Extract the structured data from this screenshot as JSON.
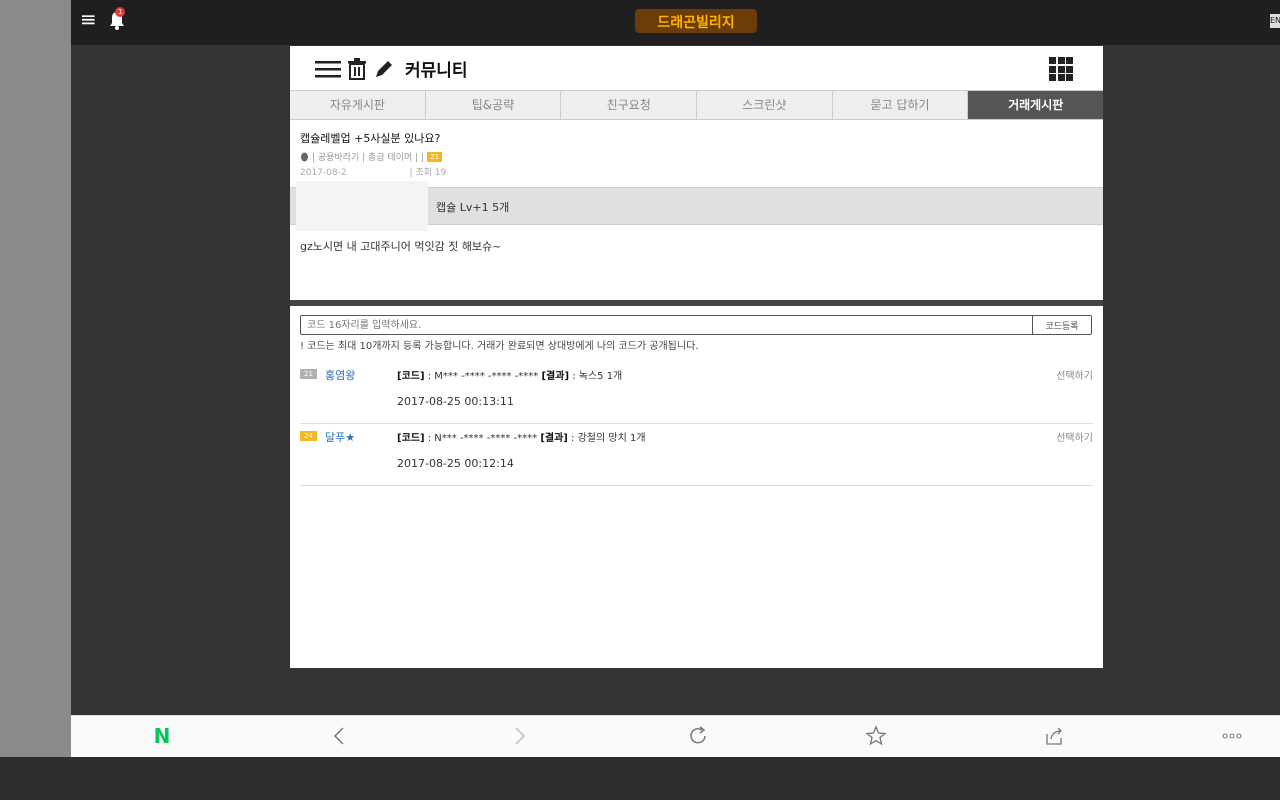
{
  "top": {
    "menu_icon": "hamburger-icon",
    "notification_count": "1"
  },
  "logo_text": "드래곤빌리지",
  "card": {
    "title": "커뮤니티",
    "tabs": [
      {
        "label": "자유게시판",
        "active": false
      },
      {
        "label": "팁&공략",
        "active": false
      },
      {
        "label": "친구요청",
        "active": false
      },
      {
        "label": "스크린샷",
        "active": false
      },
      {
        "label": "묻고 답하기",
        "active": false
      },
      {
        "label": "거래게시판",
        "active": true
      }
    ],
    "post_title": "캡슐레벨업 +5사실분 있나요?",
    "meta_text": "| 공용바라기 | 총금 테이머 | |",
    "meta_level": "21",
    "date_text": "2017-08-2",
    "views_text": "| 조회 19",
    "item_label": "캡슐 Lv+1 5개",
    "body_text": "gz노시면 내 고대주니어 먹잇감 짓 해보슈~"
  },
  "codes": {
    "input_placeholder": "코드 16자리를 입력하세요.",
    "register_button": "코드등록",
    "notice": "! 코드는 최대 10개까지 등록 가능합니다. 거래가 완료되면 상대방에게 나의 코드가 공개됩니다.",
    "entries": [
      {
        "level": "21",
        "level_color": "#b0b0b0",
        "user": "홍염왕",
        "code_label": "[코드]",
        "code_value": ": M*** -**** -**** -****",
        "result_label": "[결과]",
        "result_value": ": 녹스5 1개",
        "select": "선택하기",
        "date": "2017-08-25 00:13:11"
      },
      {
        "level": "24",
        "level_color": "#f2b824",
        "user": "달푸★",
        "code_label": "[코드]",
        "code_value": ": N*** -**** -**** -****",
        "result_label": "[결과]",
        "result_value": ": 강철의 망치 1개",
        "select": "선택하기",
        "date": "2017-08-25 00:12:14"
      }
    ]
  },
  "nav": {
    "naver_label": "N"
  }
}
